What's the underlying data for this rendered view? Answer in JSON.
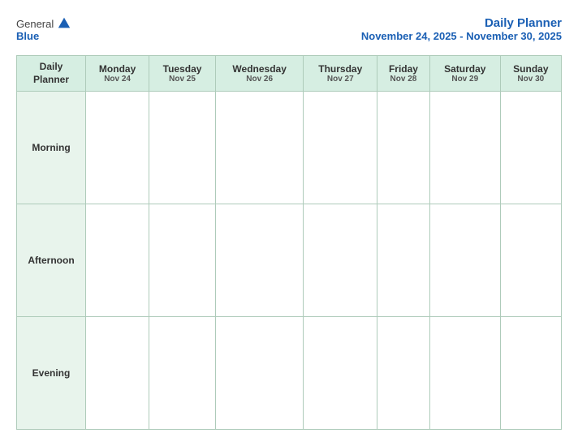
{
  "header": {
    "logo": {
      "general": "General",
      "blue": "Blue",
      "icon_alt": "GeneralBlue logo"
    },
    "title": "Daily Planner",
    "date_range": "November 24, 2025 - November 30, 2025"
  },
  "columns": [
    {
      "id": "planner-header",
      "day": "Daily\nPlanner",
      "date": ""
    },
    {
      "id": "monday",
      "day": "Monday",
      "date": "Nov 24"
    },
    {
      "id": "tuesday",
      "day": "Tuesday",
      "date": "Nov 25"
    },
    {
      "id": "wednesday",
      "day": "Wednesday",
      "date": "Nov 26"
    },
    {
      "id": "thursday",
      "day": "Thursday",
      "date": "Nov 27"
    },
    {
      "id": "friday",
      "day": "Friday",
      "date": "Nov 28"
    },
    {
      "id": "saturday",
      "day": "Saturday",
      "date": "Nov 29"
    },
    {
      "id": "sunday",
      "day": "Sunday",
      "date": "Nov 30"
    }
  ],
  "rows": [
    {
      "id": "morning",
      "label": "Morning"
    },
    {
      "id": "afternoon",
      "label": "Afternoon"
    },
    {
      "id": "evening",
      "label": "Evening"
    }
  ]
}
